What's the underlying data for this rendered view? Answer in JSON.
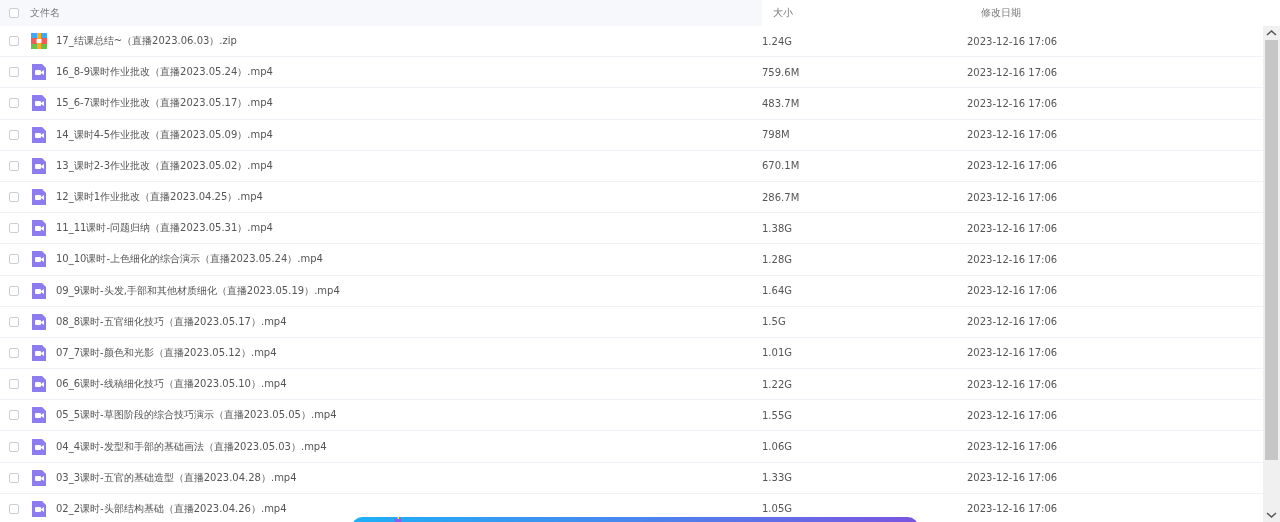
{
  "header": {
    "checked": false,
    "columns": [
      "文件名",
      "大小",
      "修改日期"
    ]
  },
  "rows": [
    {
      "kind": "zip",
      "checked": false,
      "name": "17_结课总结~（直播2023.06.03）.zip",
      "size": "1.24G",
      "date": "2023-12-16 17:06"
    },
    {
      "kind": "video",
      "checked": false,
      "name": "16_8-9课时作业批改（直播2023.05.24）.mp4",
      "size": "759.6M",
      "date": "2023-12-16 17:06"
    },
    {
      "kind": "video",
      "checked": false,
      "name": "15_6-7课时作业批改（直播2023.05.17）.mp4",
      "size": "483.7M",
      "date": "2023-12-16 17:06"
    },
    {
      "kind": "video",
      "checked": false,
      "name": "14_课时4-5作业批改（直播2023.05.09）.mp4",
      "size": "798M",
      "date": "2023-12-16 17:06"
    },
    {
      "kind": "video",
      "checked": false,
      "name": "13_课时2-3作业批改（直播2023.05.02）.mp4",
      "size": "670.1M",
      "date": "2023-12-16 17:06"
    },
    {
      "kind": "video",
      "checked": false,
      "name": "12_课时1作业批改（直播2023.04.25）.mp4",
      "size": "286.7M",
      "date": "2023-12-16 17:06"
    },
    {
      "kind": "video",
      "checked": false,
      "name": "11_11课时-问题归纳（直播2023.05.31）.mp4",
      "size": "1.38G",
      "date": "2023-12-16 17:06"
    },
    {
      "kind": "video",
      "checked": false,
      "name": "10_10课时-上色细化的综合演示（直播2023.05.24）.mp4",
      "size": "1.28G",
      "date": "2023-12-16 17:06"
    },
    {
      "kind": "video",
      "checked": false,
      "name": "09_9课时-头发,手部和其他材质细化（直播2023.05.19）.mp4",
      "size": "1.64G",
      "date": "2023-12-16 17:06"
    },
    {
      "kind": "video",
      "checked": false,
      "name": "08_8课时-五官细化技巧（直播2023.05.17）.mp4",
      "size": "1.5G",
      "date": "2023-12-16 17:06"
    },
    {
      "kind": "video",
      "checked": false,
      "name": "07_7课时-颜色和光影（直播2023.05.12）.mp4",
      "size": "1.01G",
      "date": "2023-12-16 17:06"
    },
    {
      "kind": "video",
      "checked": false,
      "name": "06_6课时-线稿细化技巧（直播2023.05.10）.mp4",
      "size": "1.22G",
      "date": "2023-12-16 17:06"
    },
    {
      "kind": "video",
      "checked": false,
      "name": "05_5课时-草图阶段的综合技巧演示（直播2023.05.05）.mp4",
      "size": "1.55G",
      "date": "2023-12-16 17:06"
    },
    {
      "kind": "video",
      "checked": false,
      "name": "04_4课时-发型和手部的基础画法（直播2023.05.03）.mp4",
      "size": "1.06G",
      "date": "2023-12-16 17:06"
    },
    {
      "kind": "video",
      "checked": false,
      "name": "03_3课时-五官的基础造型（直播2023.04.28）.mp4",
      "size": "1.33G",
      "date": "2023-12-16 17:06"
    },
    {
      "kind": "video",
      "checked": false,
      "name": "02_2课时-头部结构基础（直播2023.04.26）.mp4",
      "size": "1.05G",
      "date": "2023-12-16 17:06"
    }
  ]
}
